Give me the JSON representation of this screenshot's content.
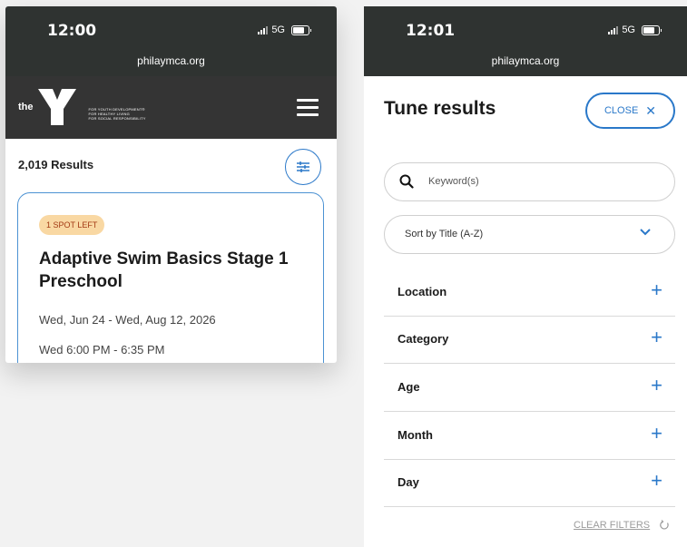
{
  "left": {
    "status": {
      "time": "12:00",
      "network": "5G"
    },
    "url": "philaymca.org",
    "logo": {
      "prefix": "the",
      "tagline": [
        "FOR YOUTH DEVELOPMENT®",
        "FOR HEALTHY LIVING",
        "FOR SOCIAL RESPONSIBILITY"
      ]
    },
    "results_count": "2,019 Results",
    "card": {
      "badge": "1 SPOT LEFT",
      "title": "Adaptive Swim Basics Stage 1 Preschool",
      "date_range": "Wed, Jun 24 - Wed, Aug 12, 2026",
      "time": "Wed 6:00 PM - 6:35 PM"
    }
  },
  "right": {
    "status": {
      "time": "12:01",
      "network": "5G"
    },
    "url": "philaymca.org",
    "title": "Tune results",
    "close_label": "CLOSE",
    "keyword_placeholder": "Keyword(s)",
    "sort_value": "Sort by Title (A-Z)",
    "facets": [
      {
        "label": "Location"
      },
      {
        "label": "Category"
      },
      {
        "label": "Age"
      },
      {
        "label": "Month"
      },
      {
        "label": "Day"
      }
    ],
    "clear_filters": "CLEAR FILTERS"
  },
  "colors": {
    "accent": "#2a78c9",
    "header": "#343434",
    "statusbar": "#2f3331",
    "badge_bg": "#f9d8a3",
    "badge_text": "#a33a14"
  },
  "icons": [
    "signal-icon",
    "battery-icon",
    "ymca-logo",
    "hamburger-menu-icon",
    "filter-sliders-icon",
    "close-icon",
    "search-icon",
    "chevron-down-icon",
    "plus-icon",
    "reset-icon"
  ]
}
